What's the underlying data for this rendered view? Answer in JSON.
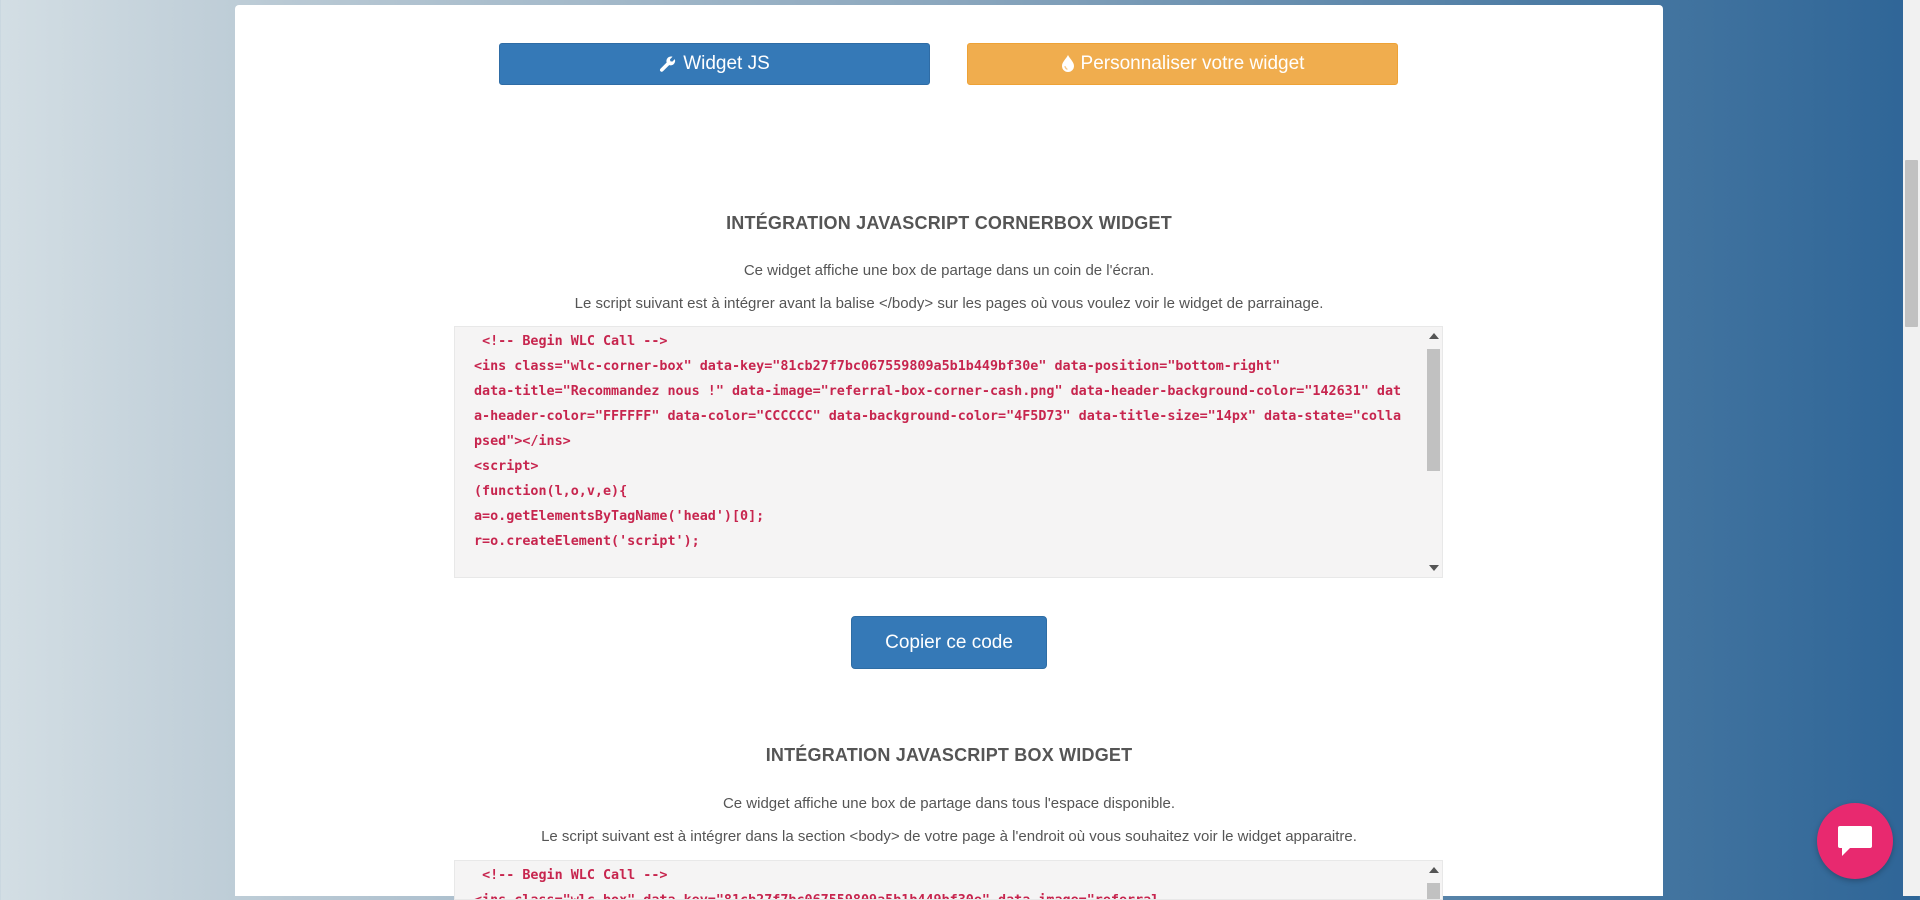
{
  "tabs": {
    "widget_js": "Widget JS",
    "customize": "Personnaliser votre widget"
  },
  "cornerbox": {
    "title": "INTÉGRATION JAVASCRIPT CORNERBOX WIDGET",
    "desc1": "Ce widget affiche une box de partage dans un coin de l'écran.",
    "desc2": "Le script suivant est à intégrer avant la balise </body> sur les pages où vous voulez voir le widget de parrainage.",
    "code": " <!-- Begin WLC Call -->\n<ins class=\"wlc-corner-box\" data-key=\"81cb27f7bc067559809a5b1b449bf30e\" data-position=\"bottom-right\"\ndata-title=\"Recommandez nous !\" data-image=\"referral-box-corner-cash.png\" data-header-background-color=\"142631\" data-header-color=\"FFFFFF\" data-color=\"CCCCCC\" data-background-color=\"4F5D73\" data-title-size=\"14px\" data-state=\"collapsed\"></ins>\n<script>\n(function(l,o,v,e){\na=o.getElementsByTagName('head')[0];\nr=o.createElement('script');"
  },
  "copy_button": "Copier ce code",
  "box": {
    "title": "INTÉGRATION JAVASCRIPT BOX WIDGET",
    "desc1": "Ce widget affiche une box de partage dans tous l'espace disponible.",
    "desc2": "Le script suivant est à intégrer dans la section <body> de votre page à l'endroit où vous souhaitez voir le widget apparaitre.",
    "code": " <!-- Begin WLC Call -->\n<ins class=\"wlc-box\" data-key=\"81cb27f7bc067559809a5b1b449bf30e\" data-image=\"referral"
  },
  "icons": {
    "widget_js": "wrench-icon",
    "customize": "tint-icon",
    "chat": "chat-icon"
  },
  "colors": {
    "primary": "#3579b7",
    "warning": "#f0ad4e",
    "code_text": "#c7254e",
    "chat": "#e8296f"
  }
}
